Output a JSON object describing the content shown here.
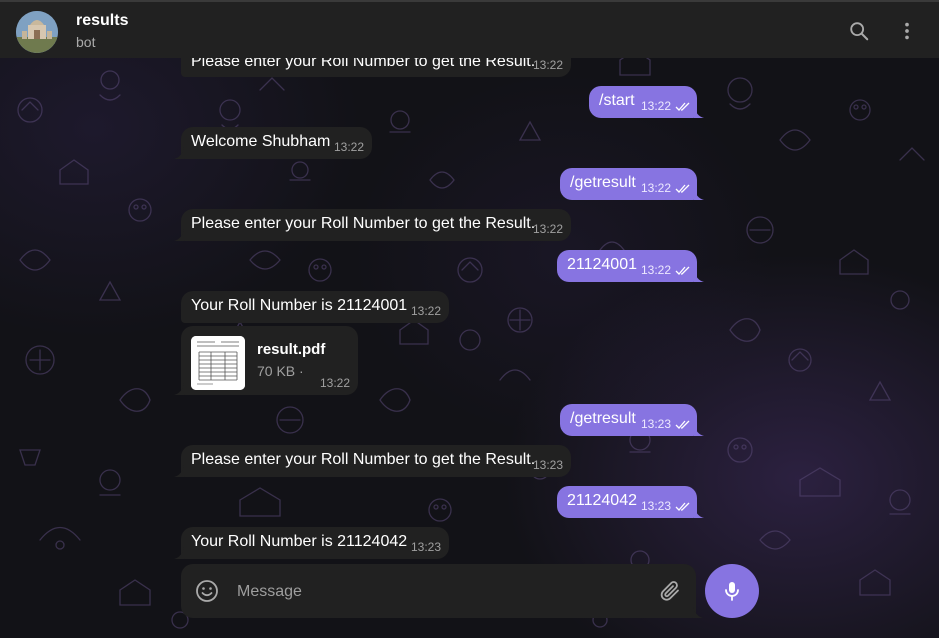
{
  "header": {
    "title": "results",
    "status": "bot"
  },
  "icons": {
    "search": "search-icon",
    "more": "more-vertical-icon",
    "emoji": "smile-icon",
    "attach": "paperclip-icon",
    "mic": "microphone-icon",
    "read": "double-check-icon"
  },
  "colors": {
    "accent": "#8774e1",
    "incoming_bubble": "#212121",
    "header_bg": "#212121"
  },
  "messages": [
    {
      "direction": "in",
      "text": "Please enter your Roll Number to get the Result.",
      "time": "13:22"
    },
    {
      "direction": "out",
      "text": "/start",
      "time": "13:22",
      "read": true
    },
    {
      "direction": "in",
      "text": "Welcome Shubham",
      "time": "13:22"
    },
    {
      "direction": "out",
      "text": "/getresult",
      "time": "13:22",
      "read": true
    },
    {
      "direction": "in",
      "text": "Please enter your Roll Number to get the Result.",
      "time": "13:22"
    },
    {
      "direction": "out",
      "text": "21124001",
      "time": "13:22",
      "read": true
    },
    {
      "direction": "in",
      "text": "Your Roll Number is 21124001",
      "time": "13:22"
    },
    {
      "direction": "in",
      "type": "document",
      "file_name": "result.pdf",
      "file_size": "70 KB ·",
      "time": "13:22"
    },
    {
      "direction": "out",
      "text": "/getresult",
      "time": "13:23",
      "read": true
    },
    {
      "direction": "in",
      "text": "Please enter your Roll Number to get the Result.",
      "time": "13:23"
    },
    {
      "direction": "out",
      "text": "21124042",
      "time": "13:23",
      "read": true
    },
    {
      "direction": "in",
      "text": "Your Roll Number is 21124042",
      "time": "13:23"
    }
  ],
  "composer": {
    "placeholder": "Message"
  }
}
